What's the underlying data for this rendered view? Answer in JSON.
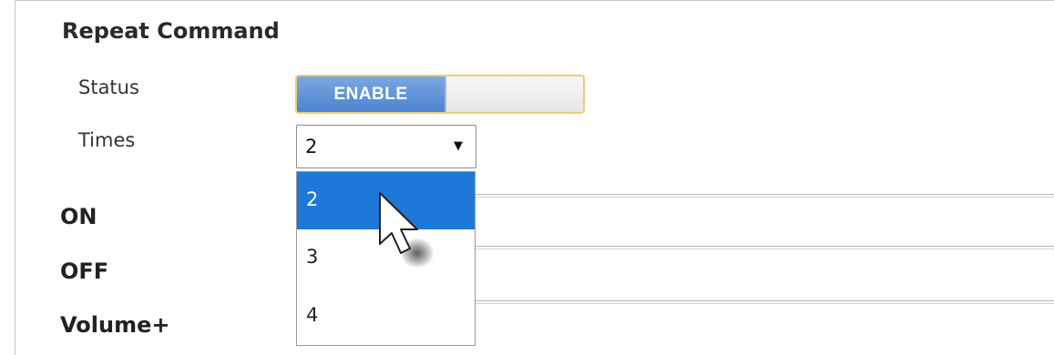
{
  "repeat_command": {
    "title": "Repeat Command",
    "status": {
      "label": "Status",
      "toggle_text": "ENABLE",
      "state": "enabled"
    },
    "times": {
      "label": "Times",
      "selected": "2",
      "arrow": "▼",
      "options": [
        "2",
        "3",
        "4"
      ],
      "highlighted_option": "2"
    }
  },
  "commands": {
    "on_label": "ON",
    "off_label": "OFF",
    "volume_up_label": "Volume+"
  },
  "colors": {
    "toggle_on": "#4d84cf",
    "toggle_border": "#e8cf78",
    "option_highlight": "#1e78d7"
  },
  "icons": {
    "cursor": "mouse-pointer-icon",
    "dropdown_arrow": "chevron-down-icon"
  }
}
